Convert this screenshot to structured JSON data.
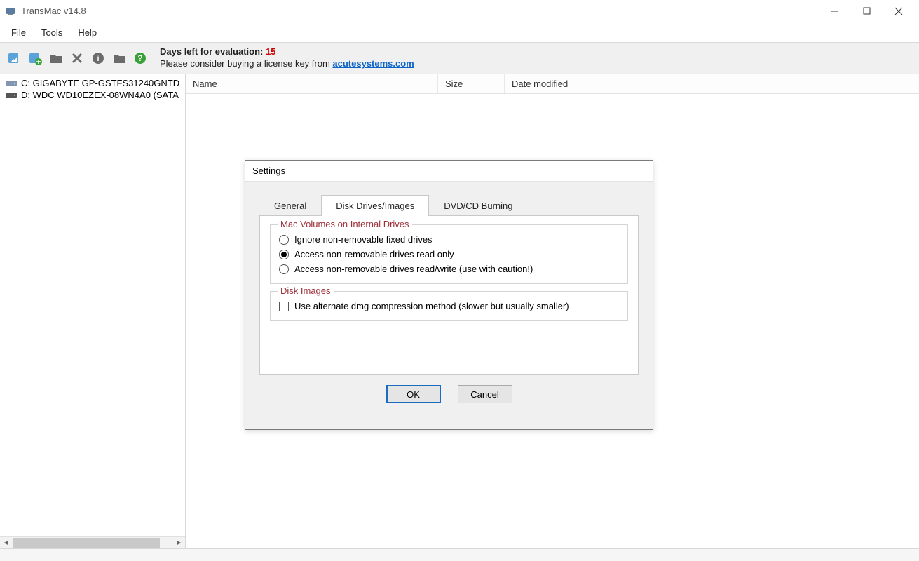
{
  "window": {
    "title": "TransMac v14.8"
  },
  "menubar": {
    "items": [
      "File",
      "Tools",
      "Help"
    ]
  },
  "eval": {
    "days_label": "Days left for evaluation: ",
    "days_value": "15",
    "please_line": "Please consider buying a license key from ",
    "link_text": "acutesystems.com"
  },
  "tree": {
    "drives": [
      {
        "label": "C:  GIGABYTE GP-GSTFS31240GNTD"
      },
      {
        "label": "D:  WDC WD10EZEX-08WN4A0 (SATA"
      }
    ]
  },
  "list": {
    "columns": {
      "name": "Name",
      "size": "Size",
      "date": "Date modified"
    }
  },
  "dialog": {
    "title": "Settings",
    "tabs": {
      "general": "General",
      "disk": "Disk Drives/Images",
      "dvd": "DVD/CD Burning"
    },
    "fs1_legend": "Mac Volumes on Internal Drives",
    "radio1": "Ignore non-removable fixed drives",
    "radio2": "Access non-removable drives read only",
    "radio3": "Access non-removable drives read/write (use with caution!)",
    "fs2_legend": "Disk Images",
    "check1": "Use alternate dmg compression method (slower but usually smaller)",
    "ok": "OK",
    "cancel": "Cancel"
  }
}
